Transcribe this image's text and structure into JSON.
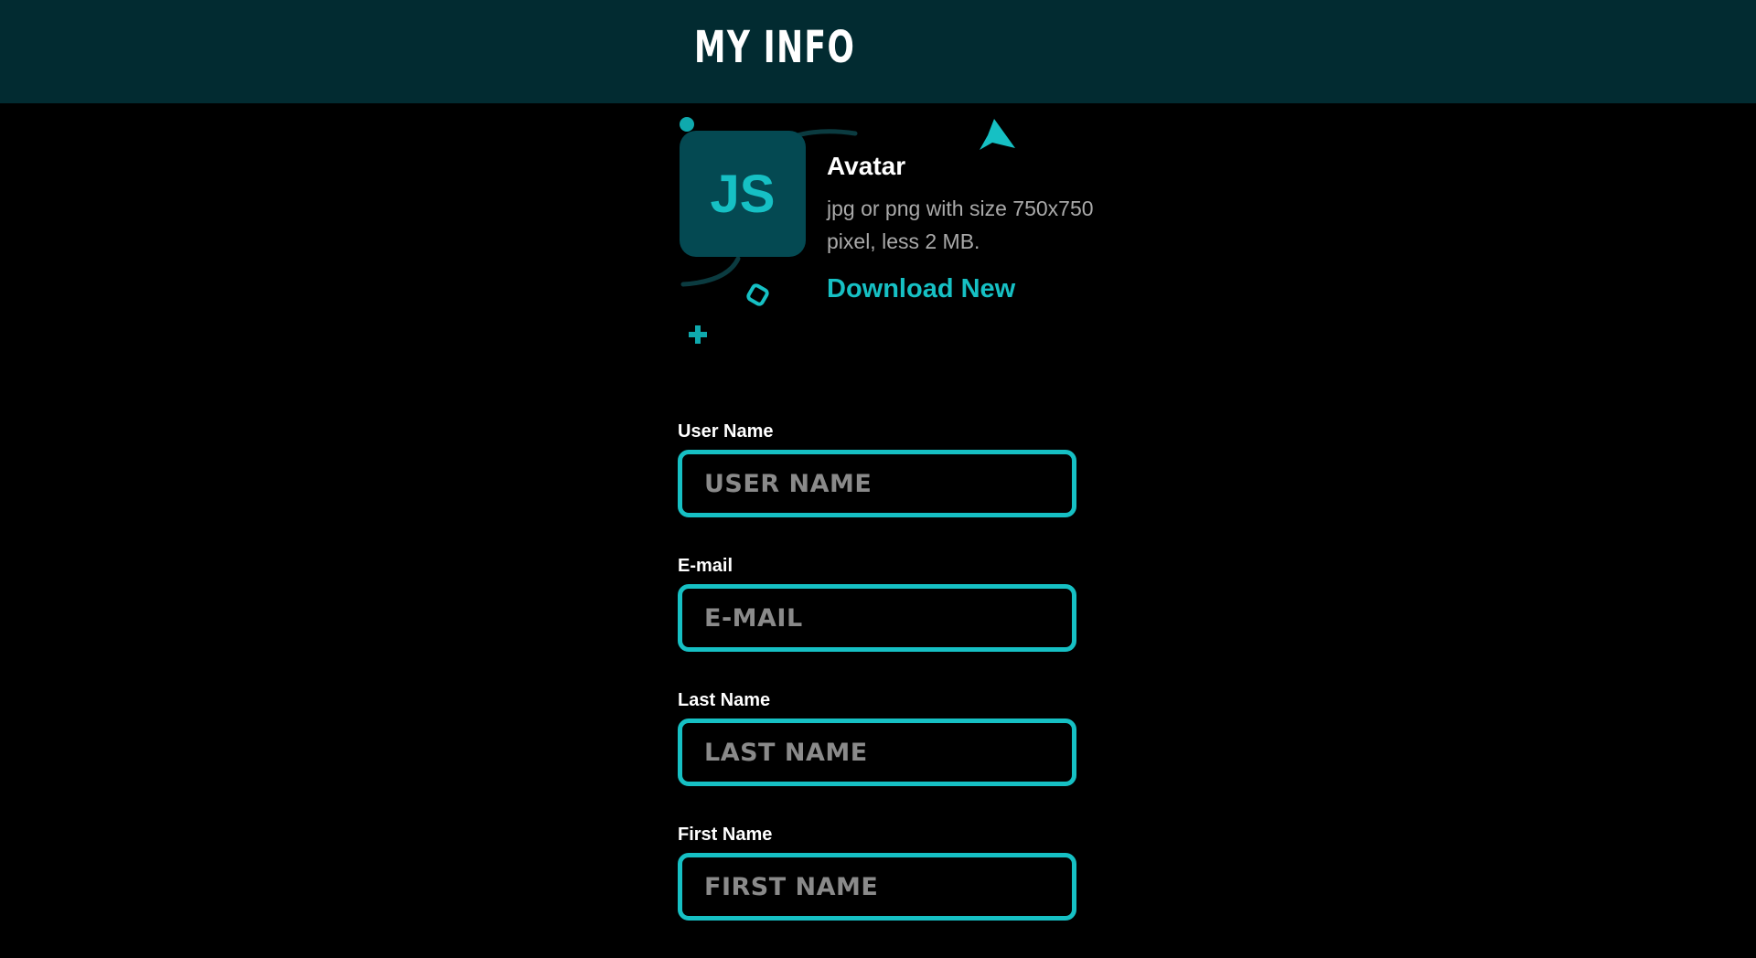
{
  "header": {
    "title": "MY INFO",
    "background": "#022b31"
  },
  "avatar": {
    "initials": "JS",
    "title": "Avatar",
    "description": "jpg or png with size 750x750 pixel, less 2 MB.",
    "download_label": "Download New",
    "decorations": [
      "dot-icon",
      "arc-icon",
      "arrow-icon",
      "ring-icon",
      "plus-icon"
    ]
  },
  "form": {
    "fields": [
      {
        "label": "User Name",
        "placeholder": "USER NAME",
        "value": ""
      },
      {
        "label": "E-mail",
        "placeholder": "E-MAIL",
        "value": ""
      },
      {
        "label": "Last Name",
        "placeholder": "LAST NAME",
        "value": ""
      },
      {
        "label": "First Name",
        "placeholder": "FIRST NAME",
        "value": ""
      }
    ]
  },
  "colors": {
    "accent": "#16c0c4",
    "avatar_bg": "#044952",
    "page_bg": "#000000",
    "muted_text": "#a9a9a9"
  }
}
